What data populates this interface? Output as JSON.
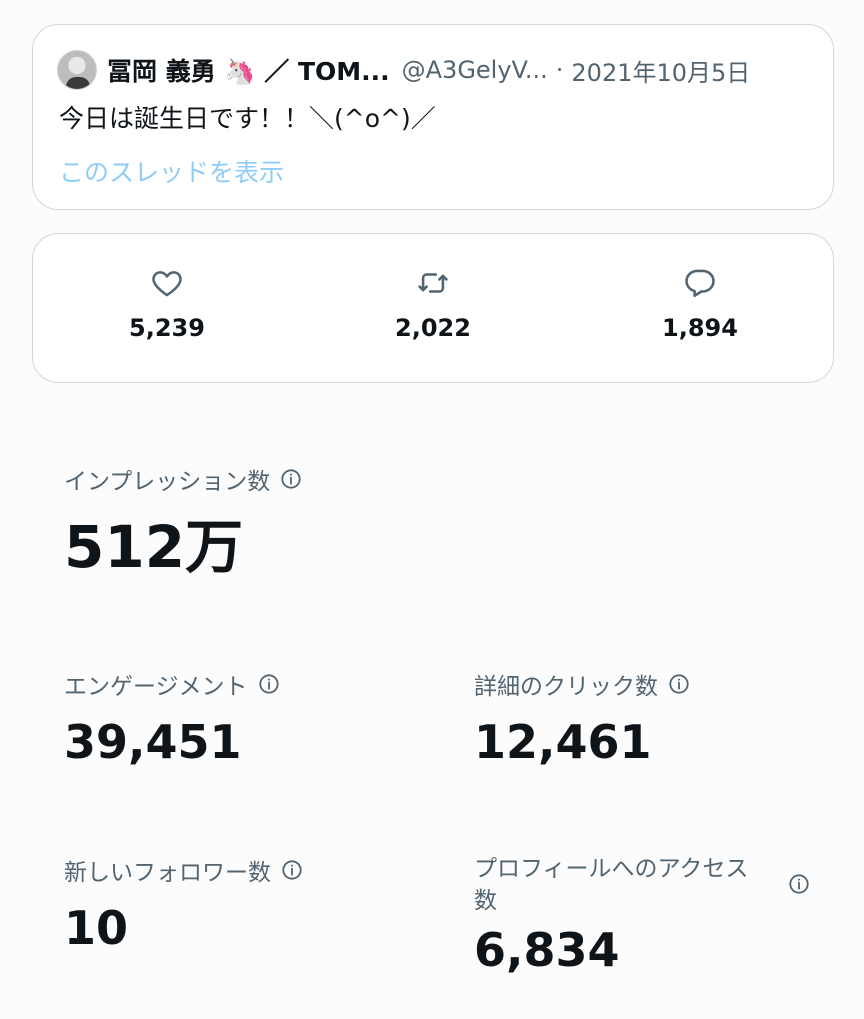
{
  "tweet": {
    "author_name": "冨岡 義勇 🦄 ／ TOM...",
    "author_handle": "@A3GelyV...",
    "separator": "·",
    "date": "2021年10月5日",
    "text": "今日は誕生日です！！＼(^o^)／",
    "thread_link": "このスレッドを表示"
  },
  "stats": {
    "likes": "5,239",
    "retweets": "2,022",
    "replies": "1,894"
  },
  "metrics": {
    "impressions": {
      "label": "インプレッション数",
      "value": "512万"
    },
    "engagement": {
      "label": "エンゲージメント",
      "value": "39,451"
    },
    "detail_clicks": {
      "label": "詳細のクリック数",
      "value": "12,461"
    },
    "new_followers": {
      "label": "新しいフォロワー数",
      "value": "10"
    },
    "profile_visits": {
      "label": "プロフィールへのアクセス数",
      "value": "6,834"
    }
  },
  "colors": {
    "link": "#8ecdf7",
    "secondary_text": "#536471",
    "border": "#cfd9de"
  },
  "icons": [
    "heart-icon",
    "retweet-icon",
    "reply-icon",
    "info-icon"
  ]
}
